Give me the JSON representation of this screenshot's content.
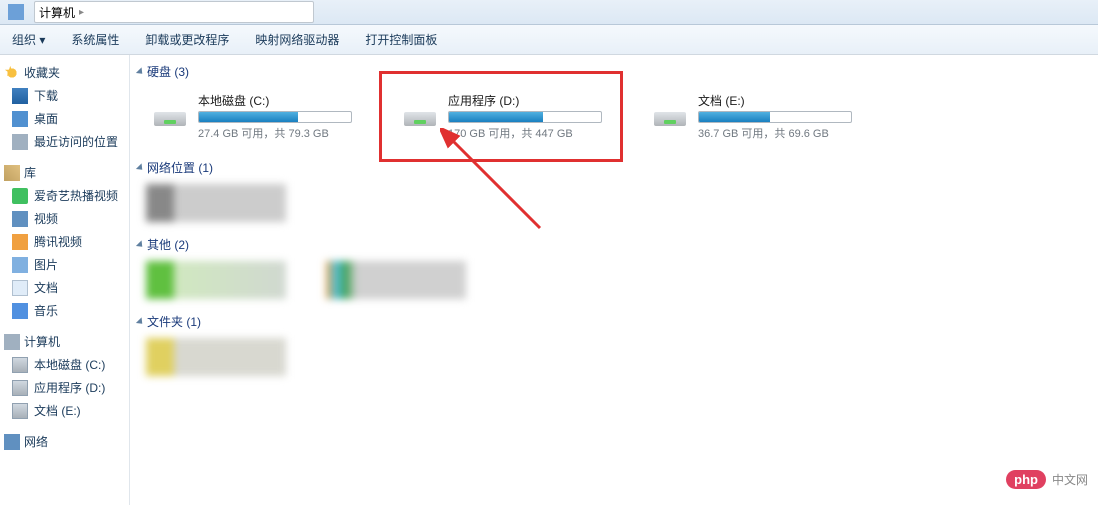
{
  "titlebar": {
    "path": "计算机"
  },
  "toolbar": {
    "organize": "组织",
    "props": "系统属性",
    "uninstall": "卸载或更改程序",
    "mapdrive": "映射网络驱动器",
    "cpanel": "打开控制面板"
  },
  "sidebar": {
    "favorites": {
      "label": "收藏夹",
      "items": [
        {
          "label": "下载",
          "icon": "dl"
        },
        {
          "label": "桌面",
          "icon": "desk"
        },
        {
          "label": "最近访问的位置",
          "icon": "recent"
        }
      ]
    },
    "library": {
      "label": "库",
      "items": [
        {
          "label": "爱奇艺热播视频",
          "icon": "iqiyi"
        },
        {
          "label": "视频",
          "icon": "video"
        },
        {
          "label": "腾讯视频",
          "icon": "tencent"
        },
        {
          "label": "图片",
          "icon": "pic"
        },
        {
          "label": "文档",
          "icon": "doc"
        },
        {
          "label": "音乐",
          "icon": "music"
        }
      ]
    },
    "computer": {
      "label": "计算机",
      "items": [
        {
          "label": "本地磁盘 (C:)",
          "icon": "drive"
        },
        {
          "label": "应用程序 (D:)",
          "icon": "drive"
        },
        {
          "label": "文档 (E:)",
          "icon": "drive"
        }
      ]
    },
    "network": {
      "label": "网络"
    }
  },
  "sections": {
    "drives": {
      "label": "硬盘 (3)"
    },
    "netloc": {
      "label": "网络位置 (1)"
    },
    "other": {
      "label": "其他 (2)"
    },
    "folders": {
      "label": "文件夹 (1)"
    }
  },
  "drives": [
    {
      "name": "本地磁盘 (C:)",
      "stat": "27.4 GB 可用，共 79.3 GB",
      "fill": 65
    },
    {
      "name": "应用程序 (D:)",
      "stat": "170 GB 可用，共 447 GB",
      "fill": 62,
      "highlight": true
    },
    {
      "name": "文档 (E:)",
      "stat": "36.7 GB 可用，共 69.6 GB",
      "fill": 47
    }
  ],
  "watermark": {
    "badge": "php",
    "text": "中文网"
  }
}
